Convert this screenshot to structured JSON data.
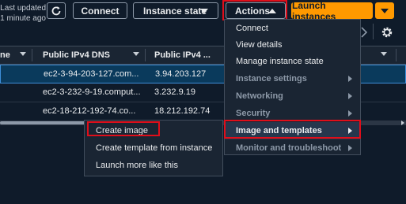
{
  "toolbar": {
    "updated_line1": "Last updated",
    "updated_line2": "1 minute ago",
    "connect_label": "Connect",
    "instance_state_label": "Instance state",
    "actions_label": "Actions",
    "launch_label": "Launch instances"
  },
  "table": {
    "columns": [
      "ne",
      "Public IPv4 DNS",
      "Public IPv4 ..."
    ],
    "rows": [
      {
        "dns": "ec2-3-94-203-127.com...",
        "ip": "3.94.203.127",
        "selected": true
      },
      {
        "dns": "ec2-3-232-9-19.comput...",
        "ip": "3.232.9.19",
        "selected": false
      },
      {
        "dns": "ec2-18-212-192-74.co...",
        "ip": "18.212.192.74",
        "selected": false
      }
    ]
  },
  "actions_menu": {
    "items": [
      {
        "label": "Connect",
        "type": "action"
      },
      {
        "label": "View details",
        "type": "action"
      },
      {
        "label": "Manage instance state",
        "type": "action"
      },
      {
        "label": "Instance settings",
        "type": "group"
      },
      {
        "label": "Networking",
        "type": "group"
      },
      {
        "label": "Security",
        "type": "group"
      },
      {
        "label": "Image and templates",
        "type": "group-active"
      },
      {
        "label": "Monitor and troubleshoot",
        "type": "group"
      }
    ]
  },
  "submenu": {
    "items": [
      "Create image",
      "Create template from instance",
      "Launch more like this"
    ]
  },
  "colors": {
    "accent_orange": "#ff9900",
    "highlight_red": "#e00e1a",
    "selected_row": "#0a3a5c"
  }
}
